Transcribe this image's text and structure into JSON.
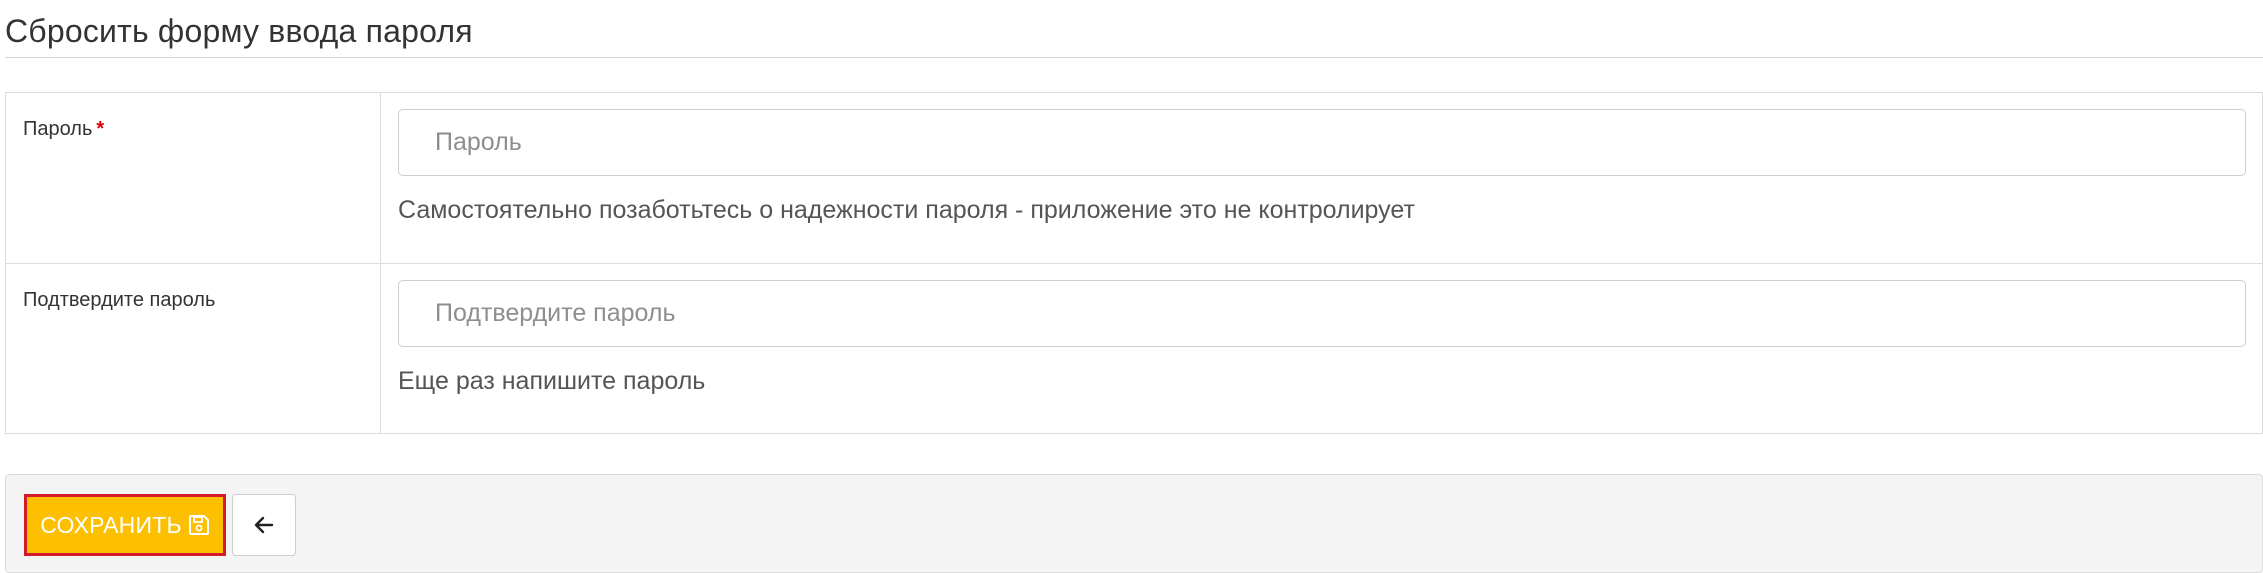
{
  "page": {
    "title": "Сбросить форму ввода пароля"
  },
  "form": {
    "password": {
      "label": "Пароль",
      "required_marker": "*",
      "value": "",
      "placeholder": "Пароль",
      "help": "Самостоятельно позаботьтесь о надежности пароля - приложение это не контролирует"
    },
    "confirm": {
      "label": "Подтвердите пароль",
      "value": "",
      "placeholder": "Подтвердите пароль",
      "help": "Еще раз напишите пароль"
    }
  },
  "actions": {
    "save_label": "СОХРАНИТЬ",
    "save_icon": "floppy-disk-icon",
    "back_icon": "arrow-left-icon"
  },
  "colors": {
    "save_button_bg": "#fcc000",
    "save_button_border": "#d21a2a",
    "required_star": "#e00000"
  }
}
